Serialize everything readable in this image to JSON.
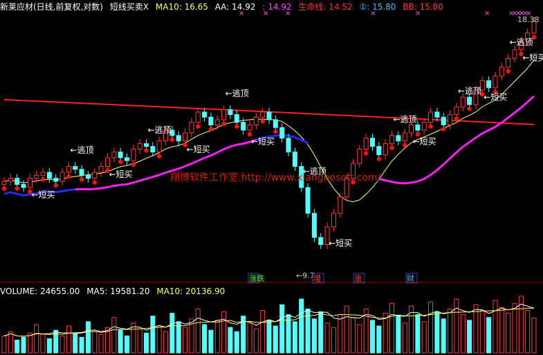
{
  "header": {
    "title": "新莱应材(日线,前复权,对数)",
    "indicator": "短线买卖X",
    "ma10": "MA10: 16.65",
    "aa": "AA: 14.92",
    "aa2": ": 14.92",
    "lifeline": "生命线: 14.52",
    "circle1": "①: 15.80",
    "bb": "BB: 15.80"
  },
  "volume_header": {
    "volume": "VOLUME: 24655.00",
    "ma5": "MA5: 19581.20",
    "ma10": "MA10: 20136.90"
  },
  "watermark": "翔博软件工作室:http://www.xiangbosoft.com/",
  "colors": {
    "bull": "#ff3c3c",
    "bear": "#54ffff",
    "lifeline": "#ff2020",
    "blue_line": "#2a2aff",
    "magenta_line": "#ff20ff",
    "ma_line": "#ffff60",
    "dots": "#ff1010",
    "label": "#ffffff"
  },
  "chart_data": {
    "type": "candlestick",
    "price_labels": {
      "high": "18.38",
      "low": "9.7"
    },
    "signals": {
      "sell_label": "逃顶",
      "buy_label": "短买"
    },
    "events": [
      "涨跌",
      "增",
      "涨",
      "财"
    ],
    "closes": [
      11.8,
      11.9,
      11.7,
      11.6,
      11.9,
      12.0,
      12.1,
      11.9,
      11.8,
      12.1,
      12.3,
      12.2,
      12.0,
      11.9,
      12.1,
      12.3,
      12.6,
      12.8,
      12.6,
      12.5,
      12.9,
      13.1,
      13.0,
      12.8,
      13.2,
      13.6,
      13.4,
      13.2,
      13.5,
      13.9,
      14.3,
      14.1,
      13.8,
      14.0,
      14.4,
      14.2,
      13.9,
      13.6,
      13.8,
      14.1,
      14.3,
      14.0,
      13.7,
      13.3,
      12.8,
      12.3,
      11.6,
      10.8,
      10.1,
      9.9,
      10.4,
      10.8,
      11.3,
      11.9,
      12.4,
      12.9,
      13.3,
      13.0,
      12.7,
      13.1,
      13.4,
      13.2,
      13.5,
      13.8,
      13.6,
      13.9,
      14.3,
      14.1,
      13.8,
      14.2,
      14.5,
      14.9,
      14.6,
      15.2,
      15.6,
      15.3,
      15.8,
      16.2,
      16.6,
      17.0,
      17.4,
      17.8,
      18.38
    ],
    "volumes": [
      12000,
      15000,
      9000,
      11000,
      14000,
      20000,
      13000,
      10000,
      16000,
      12000,
      19000,
      14000,
      11000,
      22000,
      15000,
      13000,
      18000,
      25000,
      16000,
      12000,
      21000,
      17000,
      14000,
      26000,
      19000,
      15000,
      28000,
      22000,
      18000,
      24000,
      31000,
      20000,
      16000,
      23000,
      29000,
      18000,
      15000,
      26000,
      21000,
      17000,
      30000,
      23000,
      19000,
      34000,
      27000,
      22000,
      38000,
      31000,
      24000,
      29000,
      21000,
      18000,
      27000,
      33000,
      25000,
      20000,
      31000,
      23000,
      19000,
      28000,
      35000,
      26000,
      21000,
      33000,
      27000,
      22000,
      36000,
      29000,
      24000,
      31000,
      38000,
      27000,
      23000,
      34000,
      30000,
      25000,
      37000,
      32000,
      28000,
      35000,
      40000,
      30000,
      24655
    ]
  }
}
